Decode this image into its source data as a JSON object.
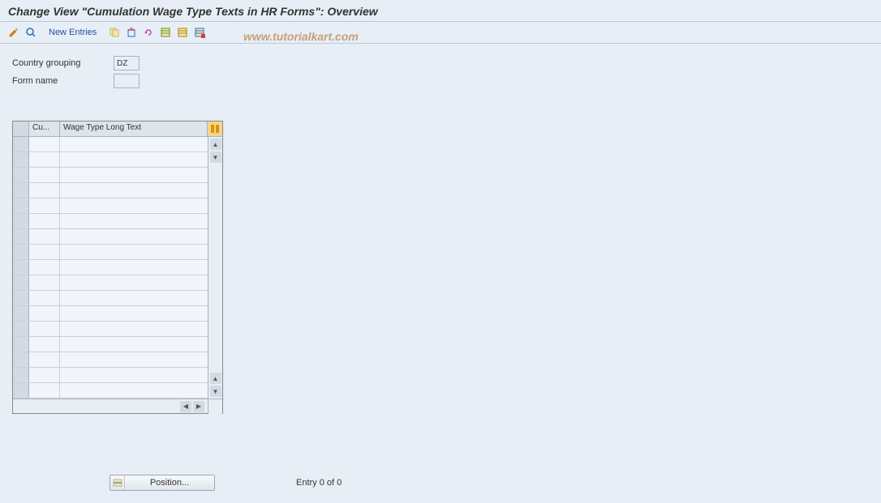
{
  "title": "Change View \"Cumulation Wage Type Texts in HR Forms\": Overview",
  "toolbar": {
    "new_entries": "New Entries"
  },
  "watermark": "www.tutorialkart.com",
  "form": {
    "country_grouping_label": "Country grouping",
    "country_grouping_value": "DZ",
    "form_name_label": "Form name",
    "form_name_value": ""
  },
  "table": {
    "col1_header": "Cu...",
    "col2_header": "Wage Type Long Text",
    "row_count": 17
  },
  "footer": {
    "position_label": "Position...",
    "entry_text": "Entry 0 of 0"
  }
}
